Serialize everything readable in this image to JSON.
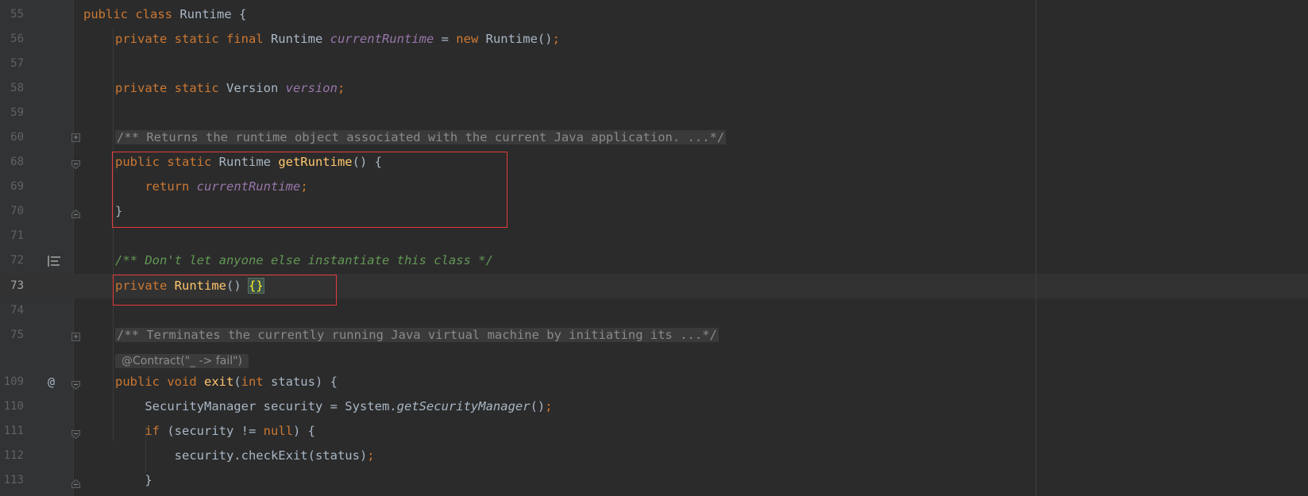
{
  "editor": {
    "lines": [
      {
        "no": "55",
        "tokens": [
          {
            "c": "kw",
            "t": "public class "
          },
          {
            "c": "type",
            "t": "Runtime {"
          }
        ]
      },
      {
        "no": "56",
        "tokens": [
          {
            "c": "kw",
            "t": "private static final "
          },
          {
            "c": "type",
            "t": "Runtime "
          },
          {
            "c": "fld",
            "t": "currentRuntime"
          },
          {
            "c": "type",
            "t": " = "
          },
          {
            "c": "kw",
            "t": "new "
          },
          {
            "c": "type",
            "t": "Runtime()"
          },
          {
            "c": "kw",
            "t": ";"
          }
        ]
      },
      {
        "no": "57",
        "tokens": []
      },
      {
        "no": "58",
        "tokens": [
          {
            "c": "kw",
            "t": "private static "
          },
          {
            "c": "type",
            "t": "Version "
          },
          {
            "c": "fld",
            "t": "version"
          },
          {
            "c": "kw",
            "t": ";"
          }
        ]
      },
      {
        "no": "59",
        "tokens": []
      },
      {
        "no": "60",
        "tokens": [
          {
            "c": "folded",
            "t": "/** Returns the runtime object associated with the current Java application. ...*/"
          }
        ]
      },
      {
        "no": "68",
        "tokens": [
          {
            "c": "kw",
            "t": "public static "
          },
          {
            "c": "type",
            "t": "Runtime "
          },
          {
            "c": "mth",
            "t": "getRuntime"
          },
          {
            "c": "type",
            "t": "() {"
          }
        ]
      },
      {
        "no": "69",
        "tokens": [
          {
            "c": "type",
            "t": "    "
          },
          {
            "c": "kw",
            "t": "return "
          },
          {
            "c": "fld",
            "t": "currentRuntime"
          },
          {
            "c": "kw",
            "t": ";"
          }
        ]
      },
      {
        "no": "70",
        "tokens": [
          {
            "c": "type",
            "t": "}"
          }
        ]
      },
      {
        "no": "71",
        "tokens": []
      },
      {
        "no": "72",
        "tokens": [
          {
            "c": "doc",
            "t": "/** Don't let anyone else instantiate this class */"
          }
        ]
      },
      {
        "no": "73",
        "tokens": [
          {
            "c": "kw",
            "t": "private "
          },
          {
            "c": "mth",
            "t": "Runtime"
          },
          {
            "c": "type",
            "t": "() "
          },
          {
            "c": "brace-hl",
            "t": "{}"
          }
        ]
      },
      {
        "no": "74",
        "tokens": []
      },
      {
        "no": "75",
        "tokens": [
          {
            "c": "folded",
            "t": "/** Terminates the currently running Java virtual machine by initiating its ...*/"
          }
        ]
      },
      {
        "no": "",
        "tokens": [
          {
            "c": "inlay",
            "t": "@Contract(\"_ -> fail\")"
          }
        ]
      },
      {
        "no": "109",
        "tokens": [
          {
            "c": "kw",
            "t": "public void "
          },
          {
            "c": "mth",
            "t": "exit"
          },
          {
            "c": "type",
            "t": "("
          },
          {
            "c": "kw",
            "t": "int "
          },
          {
            "c": "type",
            "t": "status) {"
          }
        ]
      },
      {
        "no": "110",
        "tokens": [
          {
            "c": "type",
            "t": "    SecurityManager security = System."
          },
          {
            "c": "stat",
            "t": "getSecurityManager"
          },
          {
            "c": "type",
            "t": "()"
          },
          {
            "c": "kw",
            "t": ";"
          }
        ]
      },
      {
        "no": "111",
        "tokens": [
          {
            "c": "type",
            "t": "    "
          },
          {
            "c": "kw",
            "t": "if "
          },
          {
            "c": "type",
            "t": "(security != "
          },
          {
            "c": "kw",
            "t": "null"
          },
          {
            "c": "type",
            "t": ") {"
          }
        ]
      },
      {
        "no": "112",
        "tokens": [
          {
            "c": "type",
            "t": "        security.checkExit(status)"
          },
          {
            "c": "kw",
            "t": ";"
          }
        ]
      },
      {
        "no": "113",
        "tokens": [
          {
            "c": "type",
            "t": "    }"
          }
        ]
      }
    ],
    "annotation_icon": "@",
    "colors": {
      "background": "#2b2b2b",
      "keyword": "#cc7832",
      "field": "#9876aa",
      "method": "#ffc66d",
      "doc_comment": "#629755",
      "highlight_box": "#e53b3b"
    }
  }
}
